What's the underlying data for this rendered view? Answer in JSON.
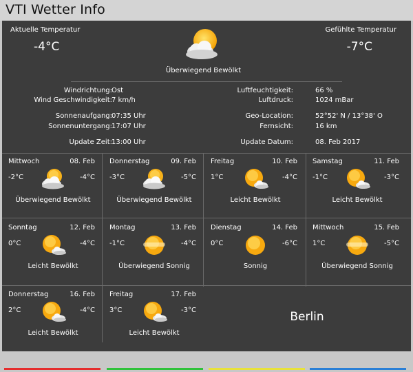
{
  "app": {
    "title": "VTI Wetter Info"
  },
  "current": {
    "label_temp": "Aktuelle Temperatur",
    "temp": "-4°C",
    "label_felt": "Gefühlte Temperatur",
    "felt": "-7°C",
    "condition": "Überwiegend Bewölkt",
    "icon": "cloud-sun-icon"
  },
  "details": {
    "wind_dir_label": "Windrichtung:",
    "wind_dir": "Ost",
    "wind_speed_label": "Wind Geschwindigkeit:",
    "wind_speed": "7 km/h",
    "sunrise_label": "Sonnenaufgang:",
    "sunrise": "07:35 Uhr",
    "sunset_label": "Sonnenuntergang:",
    "sunset": "17:07 Uhr",
    "update_time_label": "Update Zeit:",
    "update_time": "13:00 Uhr",
    "humidity_label": "Luftfeuchtigkeit:",
    "humidity": "66 %",
    "pressure_label": "Luftdruck:",
    "pressure": "1024 mBar",
    "geo_label": "Geo-Location:",
    "geo": "52°52' N  /  13°38' O",
    "visibility_label": "Fernsicht:",
    "visibility": "16 km",
    "update_date_label": "Update Datum:",
    "update_date": "08. Feb 2017"
  },
  "forecast": [
    {
      "day": "Mittwoch",
      "date": "08. Feb",
      "min": "-2°C",
      "max": "-4°C",
      "condition": "Überwiegend Bewölkt",
      "icon": "cloud-sun-icon"
    },
    {
      "day": "Donnerstag",
      "date": "09. Feb",
      "min": "-3°C",
      "max": "-5°C",
      "condition": "Überwiegend Bewölkt",
      "icon": "cloud-sun-icon"
    },
    {
      "day": "Freitag",
      "date": "10. Feb",
      "min": "1°C",
      "max": "-4°C",
      "condition": "Leicht Bewölkt",
      "icon": "sun-small-cloud-icon"
    },
    {
      "day": "Samstag",
      "date": "11. Feb",
      "min": "-1°C",
      "max": "-3°C",
      "condition": "Leicht Bewölkt",
      "icon": "sun-small-cloud-icon"
    },
    {
      "day": "Sonntag",
      "date": "12. Feb",
      "min": "0°C",
      "max": "-4°C",
      "condition": "Leicht Bewölkt",
      "icon": "sun-small-cloud-icon"
    },
    {
      "day": "Montag",
      "date": "13. Feb",
      "min": "-1°C",
      "max": "-4°C",
      "condition": "Überwiegend Sonnig",
      "icon": "hazy-sun-icon"
    },
    {
      "day": "Dienstag",
      "date": "14. Feb",
      "min": "0°C",
      "max": "-6°C",
      "condition": "Sonnig",
      "icon": "sun-icon"
    },
    {
      "day": "Mittwoch",
      "date": "15. Feb",
      "min": "1°C",
      "max": "-5°C",
      "condition": "Überwiegend Sonnig",
      "icon": "hazy-sun-icon"
    },
    {
      "day": "Donnerstag",
      "date": "16. Feb",
      "min": "2°C",
      "max": "-4°C",
      "condition": "Leicht Bewölkt",
      "icon": "sun-small-cloud-icon"
    },
    {
      "day": "Freitag",
      "date": "17. Feb",
      "min": "3°C",
      "max": "-3°C",
      "condition": "Leicht Bewölkt",
      "icon": "sun-small-cloud-icon"
    }
  ],
  "city": "Berlin",
  "colors": {
    "bar1": "#e52d2d",
    "bar2": "#2fc23a",
    "bar3": "#e8e23a",
    "bar4": "#2a7fd6"
  }
}
